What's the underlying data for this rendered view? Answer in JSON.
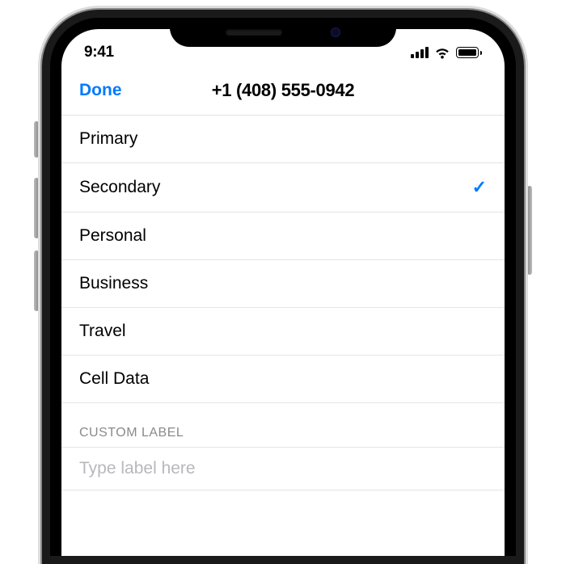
{
  "status": {
    "time": "9:41"
  },
  "nav": {
    "done": "Done",
    "title": "+1 (408) 555-0942"
  },
  "labels": [
    {
      "text": "Primary",
      "selected": false
    },
    {
      "text": "Secondary",
      "selected": true
    },
    {
      "text": "Personal",
      "selected": false
    },
    {
      "text": "Business",
      "selected": false
    },
    {
      "text": "Travel",
      "selected": false
    },
    {
      "text": "Cell Data",
      "selected": false
    }
  ],
  "custom": {
    "header": "CUSTOM LABEL",
    "placeholder": "Type label here",
    "value": ""
  }
}
